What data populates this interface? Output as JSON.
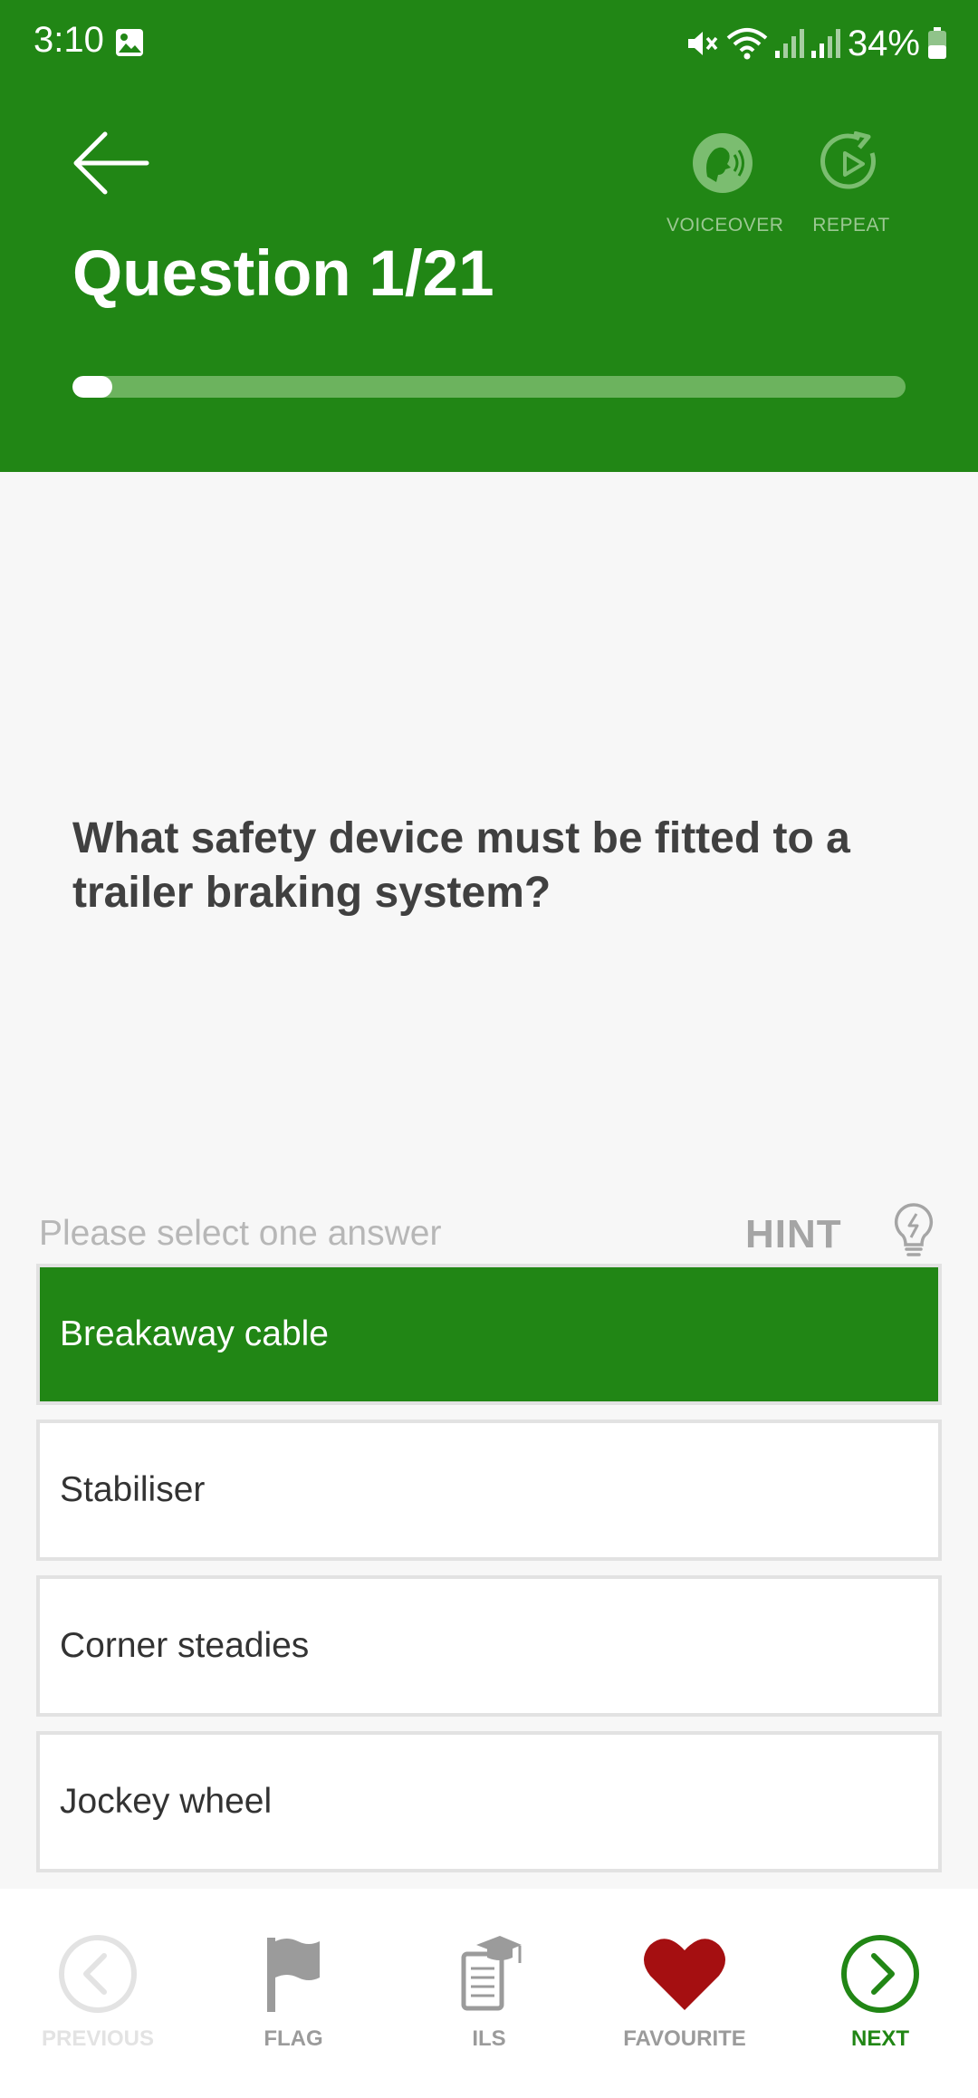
{
  "status_bar": {
    "time": "3:10",
    "battery_percent": "34%"
  },
  "header": {
    "title": "Question 1/21",
    "progress": {
      "current": 1,
      "total": 21
    },
    "voiceover_label": "VOICEOVER",
    "repeat_label": "REPEAT",
    "background_color": "#218615"
  },
  "question": {
    "text": "What safety device must be fitted to a trailer braking system?"
  },
  "answers_section": {
    "prompt": "Please select one answer",
    "hint_label": "HINT"
  },
  "answers": [
    {
      "label": "Breakaway cable",
      "selected": true
    },
    {
      "label": "Stabiliser",
      "selected": false
    },
    {
      "label": "Corner steadies",
      "selected": false
    },
    {
      "label": "Jockey wheel",
      "selected": false
    }
  ],
  "bottom_nav": {
    "previous": {
      "label": "PREVIOUS",
      "icon": "chevron-left-circle-icon",
      "color": "#e3e3e3"
    },
    "flag": {
      "label": "FLAG",
      "icon": "flag-icon",
      "color": "#9b9b9b"
    },
    "ils": {
      "label": "ILS",
      "icon": "study-book-icon",
      "color": "#9b9b9b"
    },
    "favourite": {
      "label": "FAVOURITE",
      "icon": "heart-icon",
      "color": "#a50f11"
    },
    "next": {
      "label": "NEXT",
      "icon": "chevron-right-circle-icon",
      "color": "#218615"
    }
  }
}
